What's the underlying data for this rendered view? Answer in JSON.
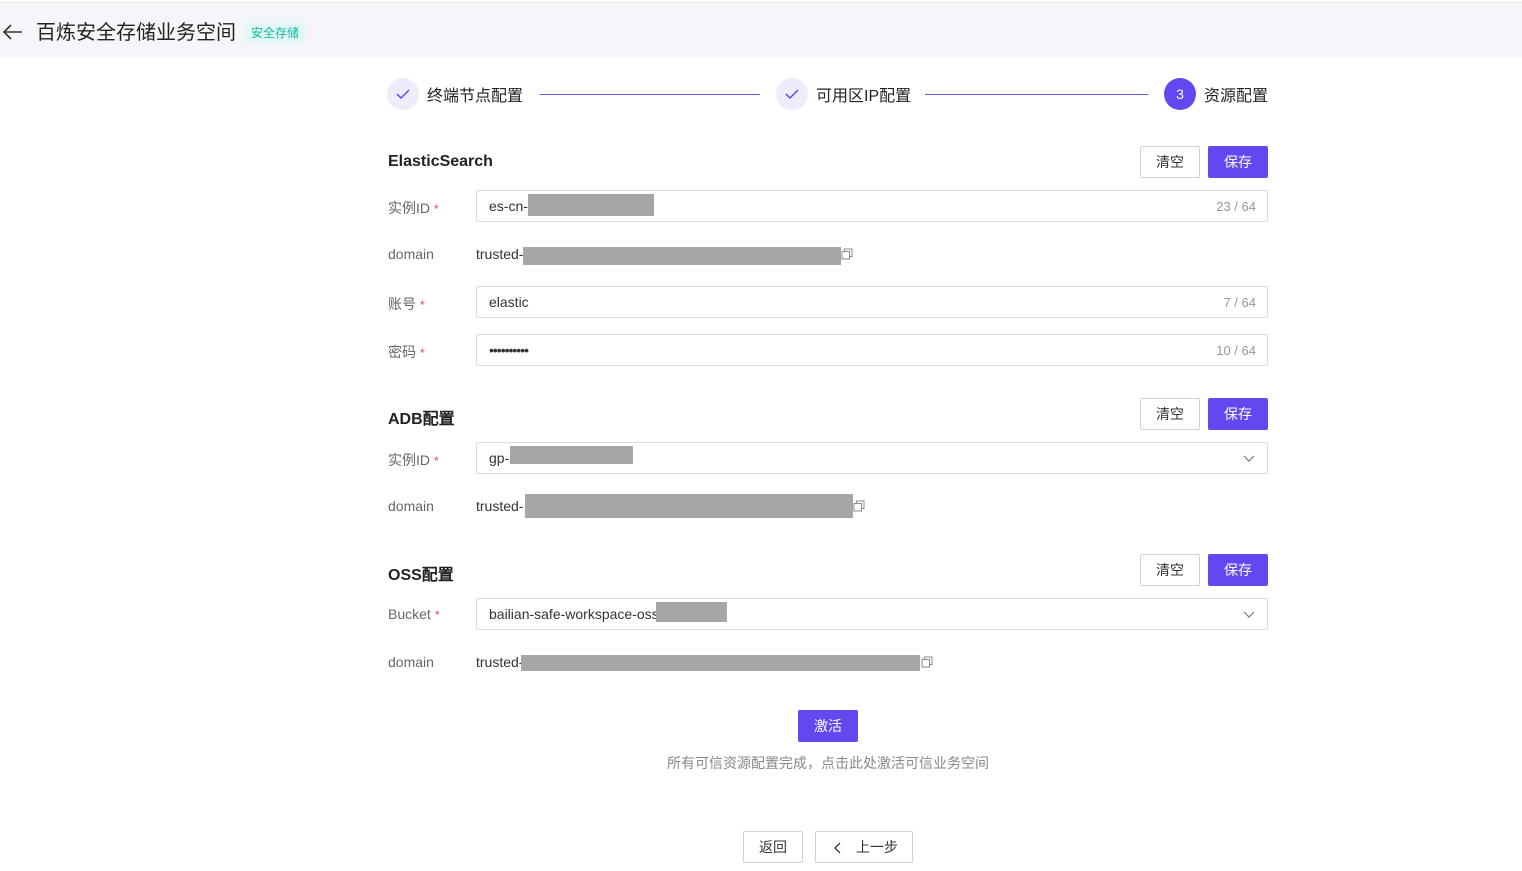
{
  "header": {
    "title": "百炼安全存储业务空间",
    "tag": "安全存储",
    "back_icon": "arrow-left-icon"
  },
  "steps": [
    {
      "label": "终端节点配置",
      "status": "done",
      "icon": "check-icon"
    },
    {
      "label": "可用区IP配置",
      "status": "done",
      "icon": "check-icon"
    },
    {
      "label": "资源配置",
      "status": "active",
      "number": "3"
    }
  ],
  "elasticsearch": {
    "title": "ElasticSearch",
    "clear_label": "清空",
    "save_label": "保存",
    "instance_label": "实例ID",
    "instance_value": "es-cn-",
    "instance_counter": "23 / 64",
    "domain_label": "domain",
    "domain_value": "trusted-",
    "account_label": "账号",
    "account_value": "elastic",
    "account_counter": "7 / 64",
    "password_label": "密码",
    "password_value": "••••••••••",
    "password_counter": "10 / 64"
  },
  "adb": {
    "title": "ADB配置",
    "clear_label": "清空",
    "save_label": "保存",
    "instance_label": "实例ID",
    "instance_value": "gp-",
    "domain_label": "domain",
    "domain_value": "trusted-"
  },
  "oss": {
    "title": "OSS配置",
    "clear_label": "清空",
    "save_label": "保存",
    "bucket_label": "Bucket",
    "bucket_value": "bailian-safe-workspace-oss",
    "domain_label": "domain",
    "domain_value": "trusted-"
  },
  "activate": {
    "button_label": "激活",
    "hint": "所有可信资源配置完成，点击此处激活可信业务空间"
  },
  "footer": {
    "back_label": "返回",
    "prev_label": "上一步"
  },
  "colors": {
    "primary": "#6248f0",
    "tag_text": "#12b8a6",
    "required": "#e5484d"
  }
}
